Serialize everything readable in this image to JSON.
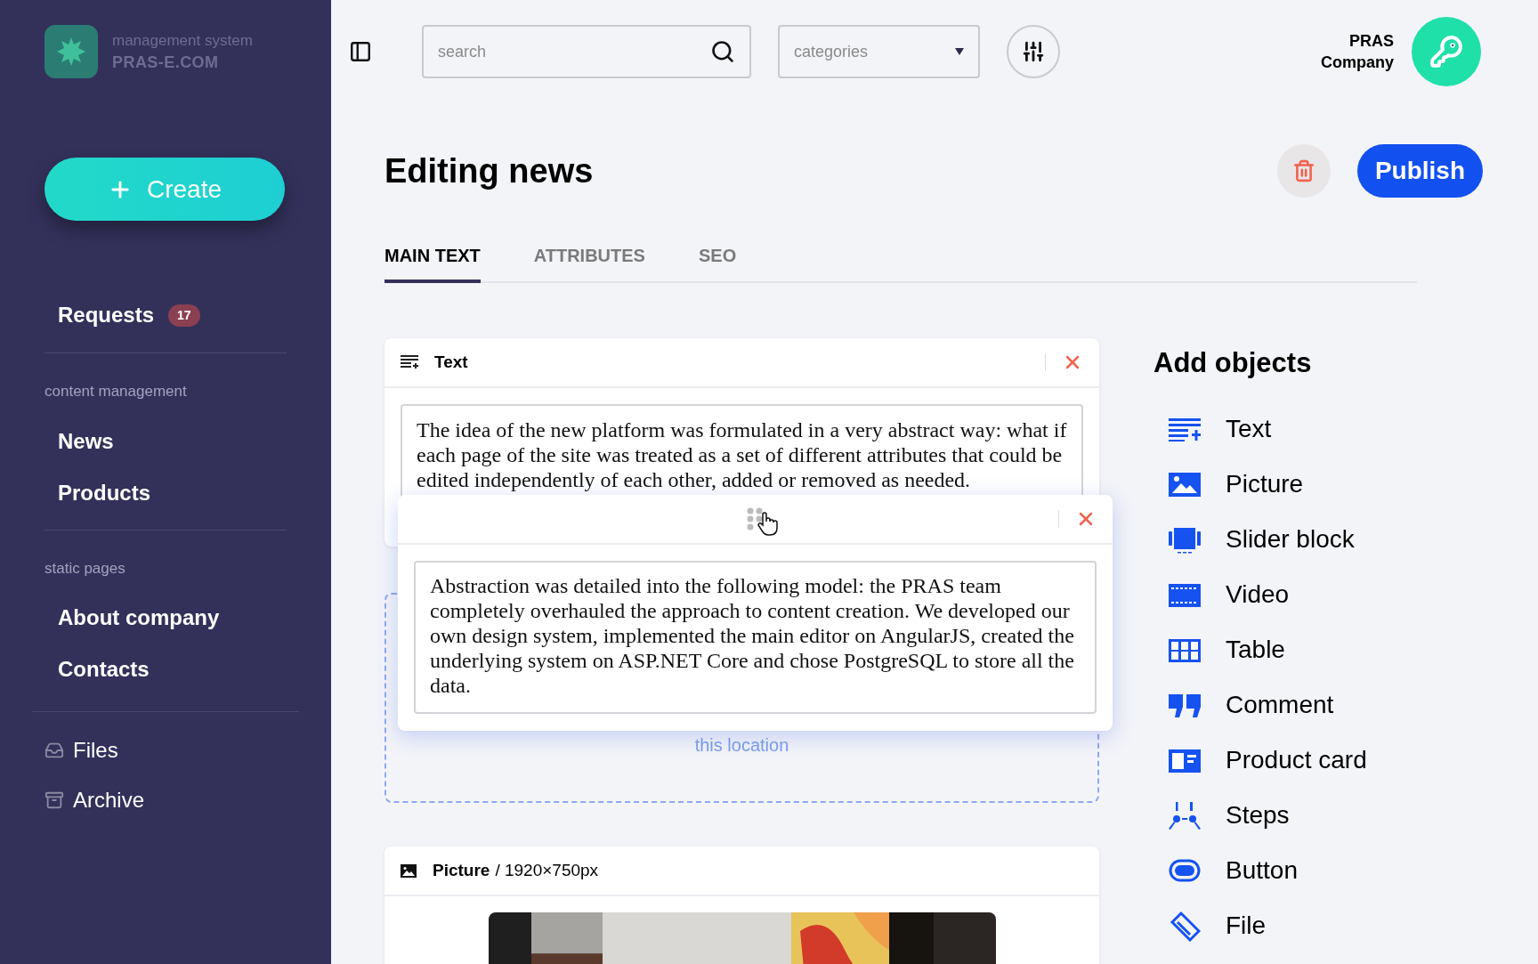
{
  "sidebar": {
    "logo": {
      "subtitle": "management system",
      "title": "PRAS-E.COM"
    },
    "create_button": "Create",
    "requests": {
      "label": "Requests",
      "badge": "17"
    },
    "sections": [
      {
        "heading": "content management",
        "items": [
          "News",
          "Products"
        ]
      },
      {
        "heading": "static pages",
        "items": [
          "About company",
          "Contacts"
        ]
      }
    ],
    "footer_items": [
      {
        "kind": "files",
        "label": "Files"
      },
      {
        "kind": "archive",
        "label": "Archive"
      }
    ]
  },
  "header": {
    "search": {
      "placeholder": "search"
    },
    "categories": {
      "placeholder": "categories"
    },
    "user": [
      "PRAS",
      "Company"
    ]
  },
  "page": {
    "title": "Editing news",
    "publish_button": "Publish",
    "tabs": [
      {
        "label": "MAIN TEXT",
        "selected": true
      },
      {
        "label": "ATTRIBUTES",
        "selected": false
      },
      {
        "label": "SEO",
        "selected": false
      }
    ],
    "text_block": {
      "title": "Text",
      "body": "The idea of the new platform was formulated in a very abstract way: what if each page of the site was treated as a set of different attributes that could be edited independently of each other, added or removed as needed."
    },
    "dragged_block": {
      "body": "Abstraction was detailed into the following model: the PRAS team completely overhauled the approach to content creation. We developed our own design system, implemented the main editor on AngularJS, created the underlying system on ASP.NET Core and chose PostgreSQL to store all the data."
    },
    "drop_zone": {
      "hint": "this location"
    },
    "picture_block": {
      "title": "Picture",
      "size": "/ 1920×750px",
      "kind": "picture"
    }
  },
  "add_objects": {
    "title": "Add objects",
    "items": [
      {
        "kind": "text",
        "label": "Text"
      },
      {
        "kind": "picture",
        "label": "Picture"
      },
      {
        "kind": "slider",
        "label": "Slider block"
      },
      {
        "kind": "video",
        "label": "Video"
      },
      {
        "kind": "table",
        "label": "Table"
      },
      {
        "kind": "comment",
        "label": "Comment"
      },
      {
        "kind": "product",
        "label": "Product card"
      },
      {
        "kind": "steps",
        "label": "Steps"
      },
      {
        "kind": "button",
        "label": "Button"
      },
      {
        "kind": "file",
        "label": "File"
      }
    ]
  }
}
